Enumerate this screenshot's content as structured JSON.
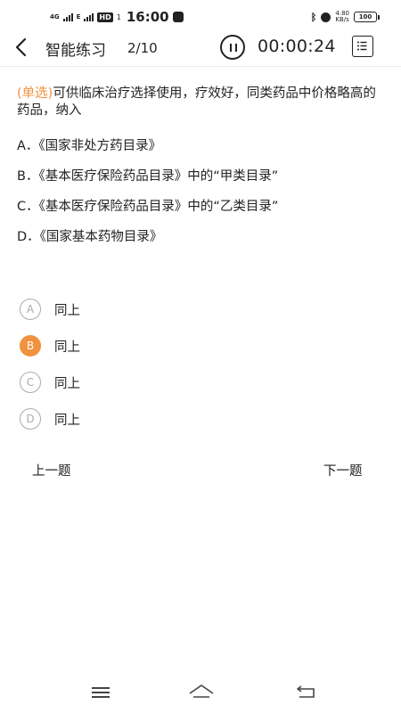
{
  "status_bar": {
    "network": "4G",
    "network2": "E",
    "hd": "HD",
    "sim": "1",
    "time": "16:00",
    "speed_value": "4.80",
    "speed_unit": "KB/s",
    "battery": "100",
    "icons": [
      "signal-icon",
      "hd-icon",
      "notification-icon",
      "bluetooth-icon",
      "alarm-icon",
      "battery-icon"
    ]
  },
  "header": {
    "title": "智能练习",
    "progress": "2/10",
    "timer": "00:00:24",
    "icons": [
      "back-icon",
      "pause-icon",
      "answer-sheet-icon"
    ]
  },
  "question": {
    "type": "(单选)",
    "text": "可供临床治疗选择使用，疗效好，同类药品中价格略高的药品，纳入",
    "options": [
      {
        "key": "A",
        "text": "A．《国家非处方药目录》"
      },
      {
        "key": "B",
        "text": "B．《基本医疗保险药品目录》中的“甲类目录”"
      },
      {
        "key": "C",
        "text": "C．《基本医疗保险药品目录》中的“乙类目录”"
      },
      {
        "key": "D",
        "text": "D．《国家基本药物目录》"
      }
    ]
  },
  "answers": [
    {
      "letter": "A",
      "label": "同上",
      "selected": false
    },
    {
      "letter": "B",
      "label": "同上",
      "selected": true
    },
    {
      "letter": "C",
      "label": "同上",
      "selected": false
    },
    {
      "letter": "D",
      "label": "同上",
      "selected": false
    }
  ],
  "nav": {
    "prev": "上一题",
    "next": "下一题"
  },
  "system_nav": {
    "icons": [
      "menu-icon",
      "home-icon",
      "back-icon"
    ]
  },
  "colors": {
    "accent": "#f0923f",
    "text": "#222222",
    "muted": "#aaaaaa"
  }
}
